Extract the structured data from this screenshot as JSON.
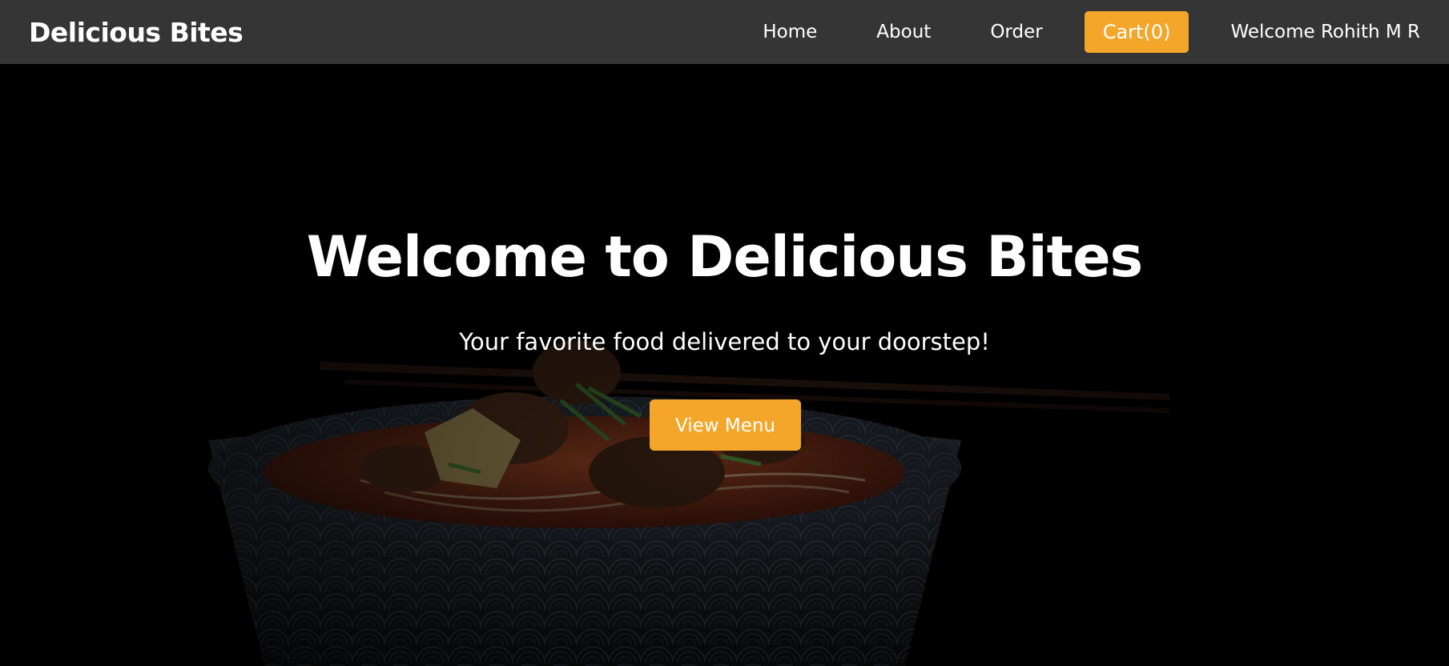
{
  "navbar": {
    "brand": "Delicious Bites",
    "links": [
      {
        "label": "Home"
      },
      {
        "label": "About"
      },
      {
        "label": "Order"
      }
    ],
    "cart_label": "Cart(0)",
    "welcome_text": "Welcome Rohith M R"
  },
  "hero": {
    "title": "Welcome to Delicious Bites",
    "subtitle": "Your favorite food delivered to your doorstep!",
    "cta_label": "View Menu",
    "background_image": "noodle-soup-bowl-with-chopsticks"
  },
  "colors": {
    "navbar_bg": "#353535",
    "accent": "#f4a62a",
    "hero_bg": "#000000"
  }
}
